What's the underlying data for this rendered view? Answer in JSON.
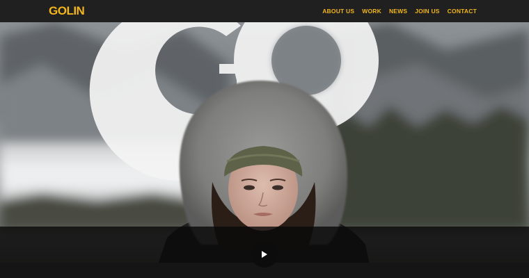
{
  "header": {
    "logo_text": "GOLIN",
    "nav": [
      {
        "label": "ABOUT US"
      },
      {
        "label": "WORK"
      },
      {
        "label": "NEWS"
      },
      {
        "label": "JOIN US"
      },
      {
        "label": "CONTACT"
      }
    ]
  },
  "hero": {
    "overlay_text": "GO",
    "image_subject": "woman in fur-trimmed winter hood with knit cap, snowy mountain landscape"
  },
  "video": {
    "play_icon": "play-icon"
  },
  "colors": {
    "brand_yellow": "#f2b51c",
    "header_bg": "#202020",
    "video_bar_bg": "#0a0a0a"
  }
}
